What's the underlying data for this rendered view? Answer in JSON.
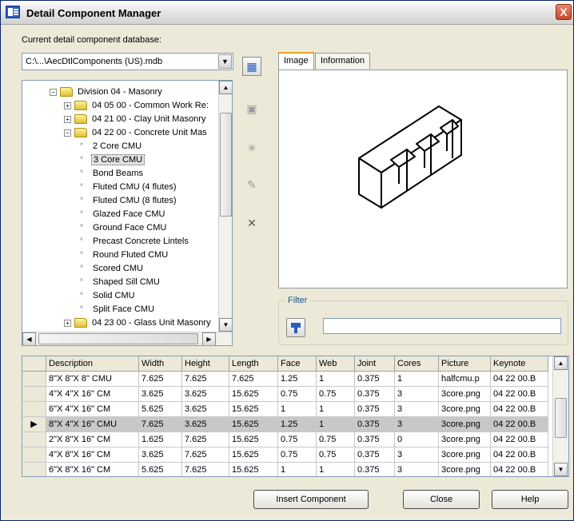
{
  "window": {
    "title": "Detail Component Manager",
    "close_glyph": "X"
  },
  "database": {
    "label": "Current detail component database:",
    "path": "C:\\...\\AecDtlComponents (US).mdb"
  },
  "toolbar_icons": [
    "edit-database-icon",
    "add-group-icon",
    "add-component-icon",
    "edit-component-icon",
    "delete-icon"
  ],
  "tree": {
    "items": [
      {
        "label": "Division 04 - Masonry",
        "toggle": "−"
      },
      {
        "label": "04 05 00 - Common Work Re:",
        "toggle": "+"
      },
      {
        "label": "04 21 00 - Clay Unit Masonry",
        "toggle": "+"
      },
      {
        "label": "04 22 00 - Concrete Unit Mas",
        "toggle": "−"
      },
      {
        "label": "2 Core CMU"
      },
      {
        "label": "3 Core CMU",
        "selected": true
      },
      {
        "label": "Bond Beams"
      },
      {
        "label": "Fluted CMU (4 flutes)"
      },
      {
        "label": "Fluted CMU (8 flutes)"
      },
      {
        "label": "Glazed Face CMU"
      },
      {
        "label": "Ground Face CMU"
      },
      {
        "label": "Precast Concrete Lintels"
      },
      {
        "label": "Round Fluted CMU"
      },
      {
        "label": "Scored CMU"
      },
      {
        "label": "Shaped Sill CMU"
      },
      {
        "label": "Solid CMU"
      },
      {
        "label": "Split Face CMU"
      },
      {
        "label": "04 23 00 - Glass Unit Masonry",
        "toggle": "+"
      }
    ]
  },
  "tabs": [
    {
      "label": "Image",
      "active": true
    },
    {
      "label": "Information",
      "active": false
    }
  ],
  "filter": {
    "label": "Filter",
    "value": ""
  },
  "grid": {
    "columns": [
      "Description",
      "Width",
      "Height",
      "Length",
      "Face",
      "Web",
      "Joint",
      "Cores",
      "Picture",
      "Keynote"
    ],
    "rows": [
      [
        "8\"X 8\"X 8\" CMU",
        "7.625",
        "7.625",
        "7.625",
        "1.25",
        "1",
        "0.375",
        "1",
        "halfcmu.p",
        "04 22 00.B"
      ],
      [
        "4\"X 4\"X 16\" CM",
        "3.625",
        "3.625",
        "15.625",
        "0.75",
        "0.75",
        "0.375",
        "3",
        "3core.png",
        "04 22 00.B"
      ],
      [
        "6\"X 4\"X 16\" CM",
        "5.625",
        "3.625",
        "15.625",
        "1",
        "1",
        "0.375",
        "3",
        "3core.png",
        "04 22 00.B"
      ],
      [
        "8\"X 4\"X 16\" CMU",
        "7.625",
        "3.625",
        "15.625",
        "1.25",
        "1",
        "0.375",
        "3",
        "3core.png",
        "04 22 00.B"
      ],
      [
        "2\"X 8\"X 16\" CM",
        "1.625",
        "7.625",
        "15.625",
        "0.75",
        "0.75",
        "0.375",
        "0",
        "3core.png",
        "04 22 00.B"
      ],
      [
        "4\"X 8\"X 16\" CM",
        "3.625",
        "7.625",
        "15.625",
        "0.75",
        "0.75",
        "0.375",
        "3",
        "3core.png",
        "04 22 00.B"
      ],
      [
        "6\"X 8\"X 16\" CM",
        "5.625",
        "7.625",
        "15.625",
        "1",
        "1",
        "0.375",
        "3",
        "3core.png",
        "04 22 00.B"
      ]
    ],
    "selected_row": 3,
    "current_row_marker": "▶"
  },
  "buttons": {
    "insert": "Insert Component",
    "close": "Close",
    "help": "Help"
  }
}
